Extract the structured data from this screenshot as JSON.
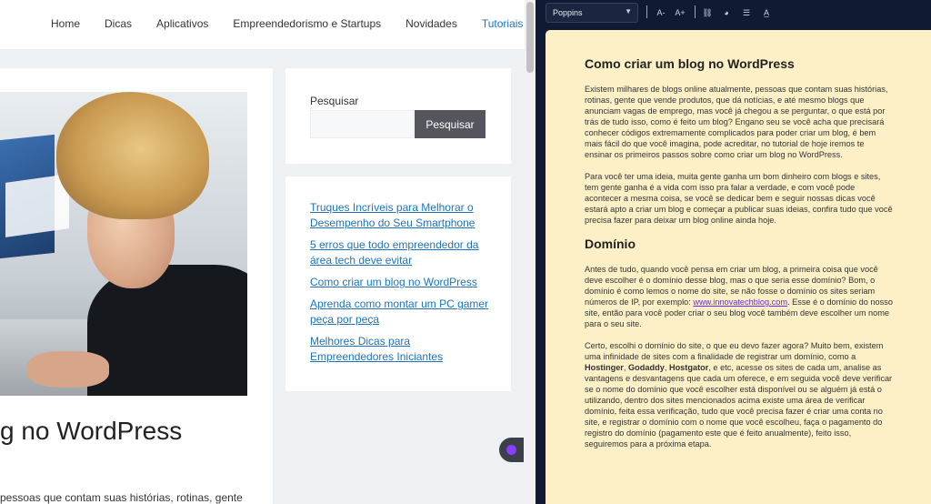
{
  "nav": {
    "items": [
      {
        "label": "Home"
      },
      {
        "label": "Dicas"
      },
      {
        "label": "Aplicativos"
      },
      {
        "label": "Empreendedorismo e Startups"
      },
      {
        "label": "Novidades"
      },
      {
        "label": "Tutoriais",
        "active": true
      }
    ]
  },
  "post": {
    "title_visible": "g no WordPress",
    "excerpt_visible": "pessoas que contam suas histórias, rotinas, gente"
  },
  "search": {
    "label": "Pesquisar",
    "placeholder": "",
    "button_label": "Pesquisar"
  },
  "recent": {
    "links": [
      "Truques Incríveis para Melhorar o Desempenho do Seu Smartphone",
      "5 erros que todo empreendedor da área tech deve evitar",
      "Como criar um blog no WordPress",
      "Aprenda como montar um PC gamer peça por peça",
      "Melhores Dicas para Empreendedores Iniciantes"
    ]
  },
  "editor": {
    "font_select": "Poppins",
    "toolbar_icons": [
      "decrease-font-icon",
      "increase-font-icon",
      "link-icon",
      "palette-icon",
      "line-spacing-icon",
      "text-style-icon"
    ],
    "toolbar_glyphs": {
      "decrease": "A-",
      "increase": "A+",
      "link": "⛓",
      "palette": "◕",
      "spacing": "☰",
      "textstyle": "A̲"
    },
    "doc": {
      "h1": "Como criar um blog no WordPress",
      "p1": "Existem milhares de blogs online atualmente, pessoas que contam suas histórias, rotinas, gente que vende produtos, que dá notícias, e até mesmo blogs que anunciam vagas de emprego, mas você já chegou a se perguntar, o que está por trás de tudo isso, como é feito um blog? Engano seu se você acha que precisará conhecer códigos extremamente complicados para poder criar um blog, é bem mais fácil do que você imagina, pode acreditar, no tutorial de hoje iremos te ensinar os primeiros passos sobre como criar um blog no WordPress.",
      "p2": "Para você ter uma ideia, muita gente ganha um bom dinheiro com blogs e sites, tem gente ganha é a vida com isso pra falar a verdade, e com você pode acontecer a mesma coisa, se você se dedicar bem e seguir nossas dicas você estará apto a criar um blog e começar a publicar suas ideias, confira tudo que você precisa fazer para deixar um blog online ainda hoje.",
      "h2": "Domínio",
      "p3_before": "Antes de tudo, quando você pensa em criar um blog, a primeira coisa que você deve escolher é o domínio desse blog, mas o que seria esse domínio? Bom, o domínio é como lemos o nome do site, se não fosse o domínio os sites seriam números de IP, por exemplo: ",
      "p3_link": "www.innovatechblog.com",
      "p3_after": ". Esse é o domínio do nosso site, então para você poder criar o seu blog você também deve escolher um nome para o seu site.",
      "p4_a": "Certo, escolhi o domínio do site, o que eu devo fazer agora? Muito bem, existem uma infinidade de sites com a finalidade de registrar um domínio, como a ",
      "p4_b1": "Hostinger",
      "p4_sep1": ", ",
      "p4_b2": "Godaddy",
      "p4_sep2": ", ",
      "p4_b3": "Hostgator",
      "p4_c": ", e etc, acesse os sites de cada um, analise as vantagens e desvantagens que cada um oferece, e em seguida você deve verificar se o nome do domínio que você escolher está disponível ou se alguém já está o utilizando, dentro dos sites mencionados acima existe uma área de verificar domínio, feita essa verificação, tudo que você precisa fazer é criar uma conta no site, e registrar o domínio com o nome que você escolheu, faça o pagamento do registro do domínio (pagamento este que é feito anualmente), feito isso, seguiremos para a próxima etapa."
    }
  },
  "colors": {
    "link": "#1e73be",
    "doc_bg": "#fdf0c6",
    "editor_bg": "#111a33",
    "fab_accent": "#8b3dff"
  }
}
